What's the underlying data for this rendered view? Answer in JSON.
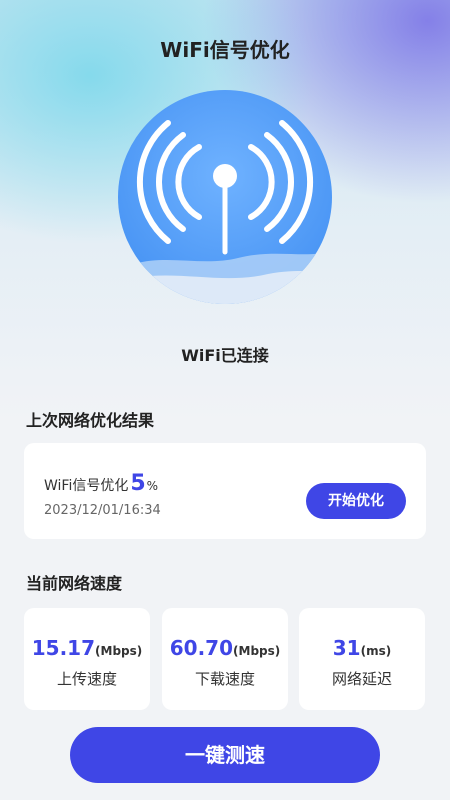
{
  "header": {
    "title": "WiFi信号优化"
  },
  "status": {
    "text": "WiFi已连接"
  },
  "icons": {
    "hero": "wifi-signal-tower-icon"
  },
  "colors": {
    "accent": "#3f46e6",
    "circle": "#4c97f5"
  },
  "last_result": {
    "section_title": "上次网络优化结果",
    "label": "WiFi信号优化",
    "percent": "5",
    "percent_unit": "%",
    "timestamp": "2023/12/01/16:34",
    "button_label": "开始优化"
  },
  "current_speed": {
    "section_title": "当前网络速度",
    "items": [
      {
        "value": "15.17",
        "unit": "(Mbps)",
        "label": "上传速度"
      },
      {
        "value": "60.70",
        "unit": "(Mbps)",
        "label": "下载速度"
      },
      {
        "value": "31",
        "unit": "(ms)",
        "label": "网络延迟"
      }
    ]
  },
  "test_button": {
    "label": "一键测速"
  }
}
